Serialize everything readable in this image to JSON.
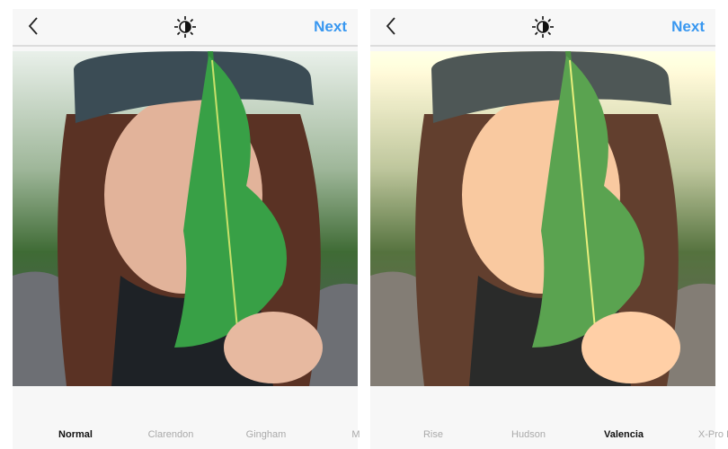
{
  "panels": [
    {
      "header": {
        "back_icon": "chevron-left-icon",
        "center_icon": "brightness-contrast-icon",
        "next_label": "Next"
      },
      "photo_filter": "Normal",
      "filters": [
        {
          "label": "Normal",
          "selected": true
        },
        {
          "label": "Clarendon",
          "selected": false
        },
        {
          "label": "Gingham",
          "selected": false
        },
        {
          "label": "M",
          "selected": false
        }
      ]
    },
    {
      "header": {
        "back_icon": "chevron-left-icon",
        "center_icon": "brightness-contrast-icon",
        "next_label": "Next"
      },
      "photo_filter": "Valencia",
      "filters": [
        {
          "label": "Rise",
          "selected": false
        },
        {
          "label": "Hudson",
          "selected": false
        },
        {
          "label": "Valencia",
          "selected": true
        },
        {
          "label": "X-Pro I",
          "selected": false
        }
      ]
    }
  ],
  "colors": {
    "accent": "#3897f0",
    "selected_text": "#111111",
    "unselected_text": "#aaaaaa"
  }
}
